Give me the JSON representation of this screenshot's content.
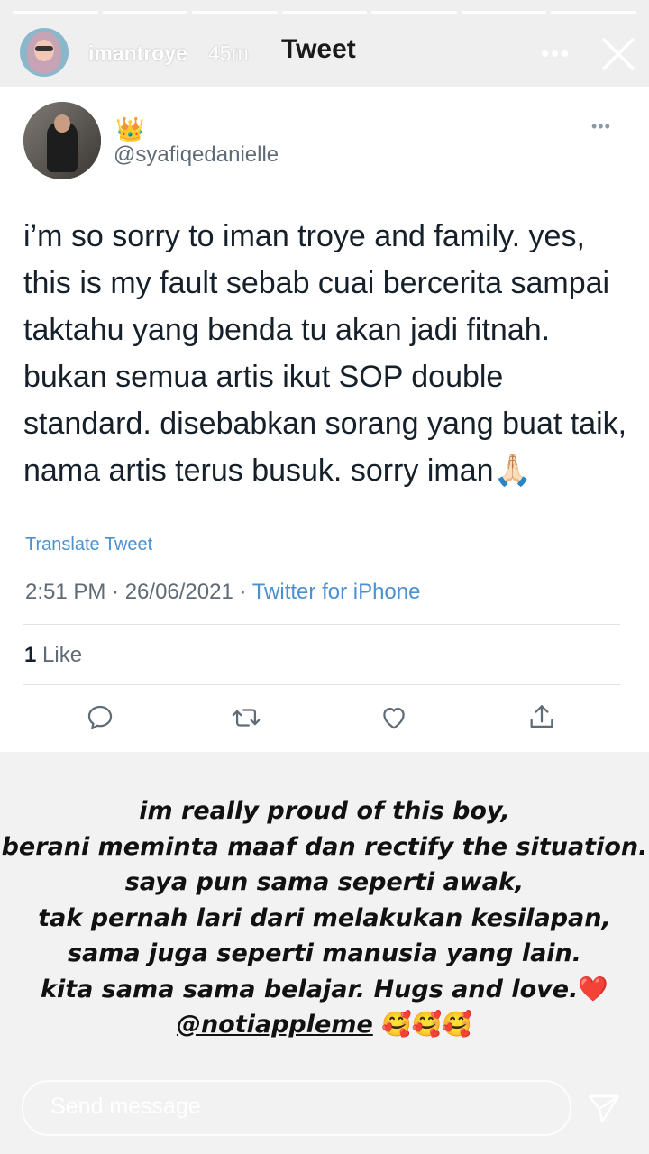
{
  "story": {
    "username": "imantroye",
    "time": "45m",
    "title": "Tweet",
    "more_label": "•••",
    "progress_segments": 7,
    "progress_completed": 7
  },
  "tweet": {
    "handle": "@syafiqedanielle",
    "crown_icon": "👑",
    "more_label": "•••",
    "text": "i’m so sorry to iman troye and family. yes, this is my fault sebab cuai bercerita sampai taktahu yang benda tu akan jadi fitnah. bukan semua artis ikut SOP double standard. disebabkan sorang yang buat taik, nama artis terus busuk. sorry iman🙏🏻",
    "translate_label": "Translate Tweet",
    "timestamp": "2:51 PM · 26/06/2021 · ",
    "source": "Twitter for iPhone",
    "like_count": "1",
    "like_label": "Like",
    "actions": [
      "reply-icon",
      "retweet-icon",
      "heart-icon",
      "share-icon"
    ]
  },
  "caption": {
    "lines": [
      "im really proud of this boy,",
      "berani meminta maaf dan rectify the situation.",
      "saya pun sama seperti awak,",
      "tak pernah lari dari melakukan kesilapan,",
      "sama juga seperti manusia yang lain.",
      "kita sama sama belajar. Hugs and love."
    ],
    "heart_emoji": "❤️",
    "mention": "@notiappleme",
    "face_emojis": "🥰🥰🥰"
  },
  "send": {
    "placeholder": "Send message"
  },
  "colors": {
    "link": "#4b91d2",
    "meta": "#5f6b76",
    "text": "#16202a"
  }
}
